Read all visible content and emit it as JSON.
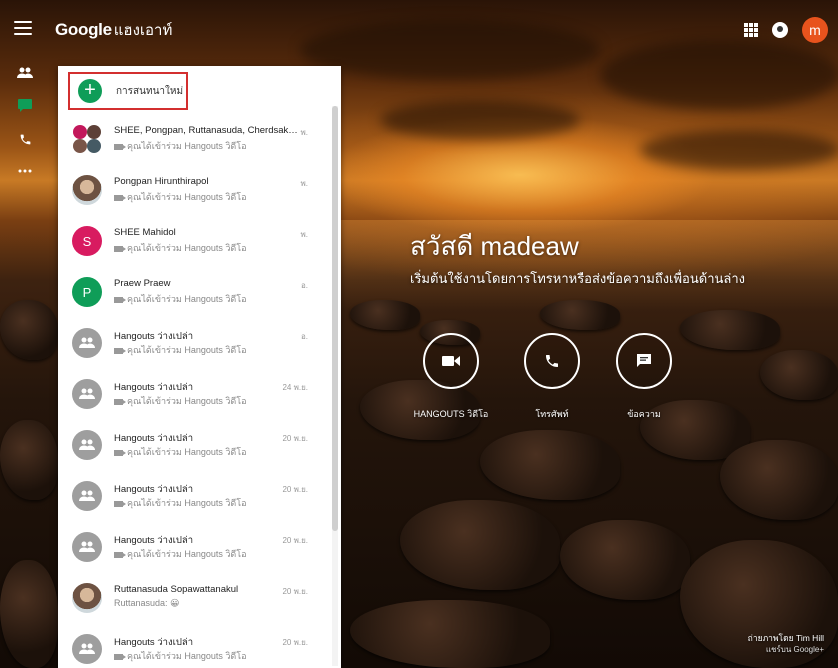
{
  "app": {
    "brand_google": "Google",
    "brand_product": "แฮงเอาท์"
  },
  "topbar": {
    "avatar_letter": "m",
    "avatar_color": "#e8531d",
    "icons": [
      "apps-icon",
      "notifications-icon"
    ]
  },
  "rail": {
    "items": [
      "contacts-icon",
      "chat-icon",
      "phone-icon",
      "more-icon"
    ],
    "active_color": "#0f9d58"
  },
  "new_chat": {
    "label": "การสนทนาใหม่"
  },
  "conversations": [
    {
      "name": "SHEE, Pongpan, Ruttanasuda, Cherdsak ...",
      "sub": "คุณได้เข้าร่วม Hangouts วิดีโอ",
      "time": "พ.",
      "avatar": "group-photo",
      "initial": ""
    },
    {
      "name": "Pongpan Hirunthirapol",
      "sub": "คุณได้เข้าร่วม Hangouts วิดีโอ",
      "time": "พ.",
      "avatar": "photo",
      "initial": ""
    },
    {
      "name": "SHEE Mahidol",
      "sub": "คุณได้เข้าร่วม Hangouts วิดีโอ",
      "time": "พ.",
      "avatar": "letter",
      "initial": "S",
      "color": "#d81b60"
    },
    {
      "name": "Praew Praew",
      "sub": "คุณได้เข้าร่วม Hangouts วิดีโอ",
      "time": "อ.",
      "avatar": "letter",
      "initial": "P",
      "color": "#0f9d58"
    },
    {
      "name": "Hangouts ว่างเปล่า",
      "sub": "คุณได้เข้าร่วม Hangouts วิดีโอ",
      "time": "อ.",
      "avatar": "group-icon",
      "initial": ""
    },
    {
      "name": "Hangouts ว่างเปล่า",
      "sub": "คุณได้เข้าร่วม Hangouts วิดีโอ",
      "time": "24 พ.ย.",
      "avatar": "group-icon",
      "initial": ""
    },
    {
      "name": "Hangouts ว่างเปล่า",
      "sub": "คุณได้เข้าร่วม Hangouts วิดีโอ",
      "time": "20 พ.ย.",
      "avatar": "group-icon",
      "initial": ""
    },
    {
      "name": "Hangouts ว่างเปล่า",
      "sub": "คุณได้เข้าร่วม Hangouts วิดีโอ",
      "time": "20 พ.ย.",
      "avatar": "group-icon",
      "initial": ""
    },
    {
      "name": "Hangouts ว่างเปล่า",
      "sub": "คุณได้เข้าร่วม Hangouts วิดีโอ",
      "time": "20 พ.ย.",
      "avatar": "group-icon",
      "initial": ""
    },
    {
      "name": "Ruttanasuda Sopawattanakul",
      "sub": "Ruttanasuda: 😀",
      "time": "20 พ.ย.",
      "avatar": "photo",
      "initial": ""
    },
    {
      "name": "Hangouts ว่างเปล่า",
      "sub": "คุณได้เข้าร่วม Hangouts วิดีโอ",
      "time": "20 พ.ย.",
      "avatar": "group-icon",
      "initial": ""
    }
  ],
  "main": {
    "greeting": "สวัสดี madeaw",
    "subtitle": "เริ่มต้นใช้งานโดยการโทรหาหรือส่งข้อความถึงเพื่อนด้านล่าง",
    "actions": [
      {
        "label": "HANGOUTS วิดีโอ",
        "icon": "video-icon"
      },
      {
        "label": "โทรศัพท์",
        "icon": "phone-icon"
      },
      {
        "label": "ข้อความ",
        "icon": "message-icon"
      }
    ]
  },
  "credit": {
    "photo_by": "ถ่ายภาพโดย Tim Hill",
    "share_link": "แชร์บน Google+"
  }
}
